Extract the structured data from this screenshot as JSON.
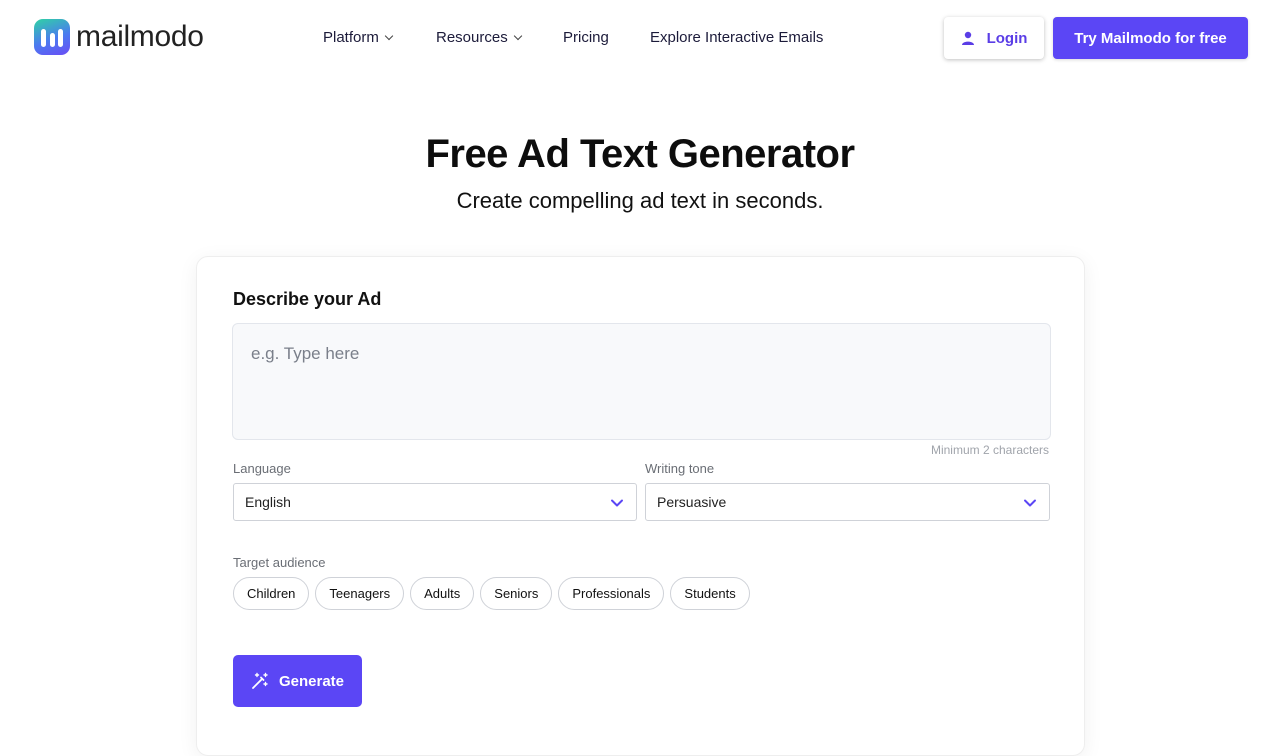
{
  "header": {
    "logo_text": "mailmodo",
    "nav": [
      {
        "label": "Platform",
        "has_dropdown": true
      },
      {
        "label": "Resources",
        "has_dropdown": true
      },
      {
        "label": "Pricing",
        "has_dropdown": false
      },
      {
        "label": "Explore Interactive Emails",
        "has_dropdown": false
      }
    ],
    "login_label": "Login",
    "cta_label": "Try Mailmodo for free"
  },
  "hero": {
    "title": "Free Ad Text Generator",
    "subtitle": "Create compelling ad text in seconds."
  },
  "form": {
    "describe_label": "Describe your Ad",
    "describe_placeholder": "e.g. Type here",
    "min_chars_note": "Minimum 2 characters",
    "language_label": "Language",
    "language_value": "English",
    "tone_label": "Writing tone",
    "tone_value": "Persuasive",
    "audience_label": "Target audience",
    "audience_options": [
      "Children",
      "Teenagers",
      "Adults",
      "Seniors",
      "Professionals",
      "Students"
    ],
    "generate_label": "Generate"
  },
  "colors": {
    "accent": "#5b46f5",
    "login_text": "#5a3de6",
    "nav_text": "#1c1b3a"
  },
  "icons": {
    "logo": "mailmodo-logo-icon",
    "login": "user-icon",
    "dropdown": "chevron-down-icon",
    "generate": "magic-wand-icon"
  }
}
